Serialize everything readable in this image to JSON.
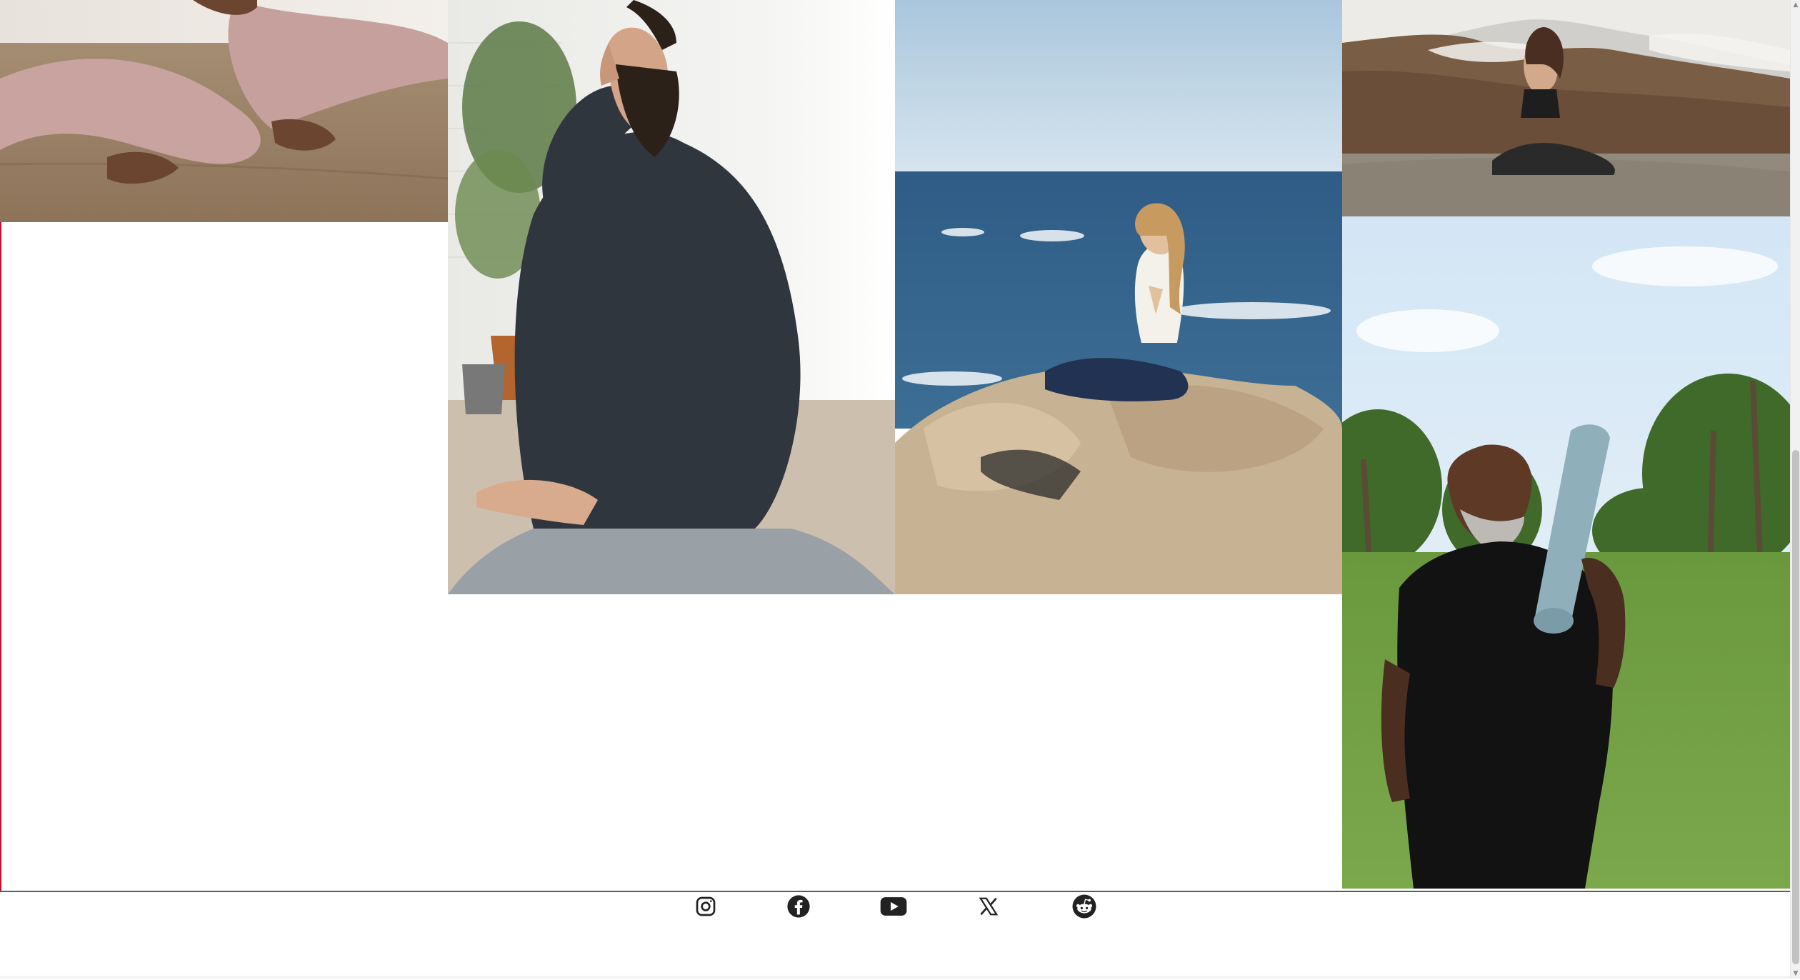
{
  "gallery": {
    "photos": [
      {
        "name": "seated-woman-closeup-photo",
        "icon": "photo"
      },
      {
        "name": "man-alternate-nostril-breathing-photo",
        "icon": "photo"
      },
      {
        "name": "woman-meditating-on-seaside-rocks-photo",
        "icon": "photo"
      },
      {
        "name": "woman-meditating-on-mountain-photo",
        "icon": "photo"
      },
      {
        "name": "man-with-yoga-mat-in-park-photo",
        "icon": "photo"
      }
    ]
  },
  "footer": {
    "social_links": [
      {
        "name": "instagram",
        "icon": "instagram-icon"
      },
      {
        "name": "facebook",
        "icon": "facebook-icon"
      },
      {
        "name": "youtube",
        "icon": "youtube-icon"
      },
      {
        "name": "x",
        "icon": "x-icon"
      },
      {
        "name": "reddit",
        "icon": "reddit-icon"
      }
    ]
  },
  "colors": {
    "footer_border": "#5a5a5a",
    "icon": "#222222",
    "page_background": "#ffffff",
    "scrollbar_thumb": "#c1c1c1"
  }
}
